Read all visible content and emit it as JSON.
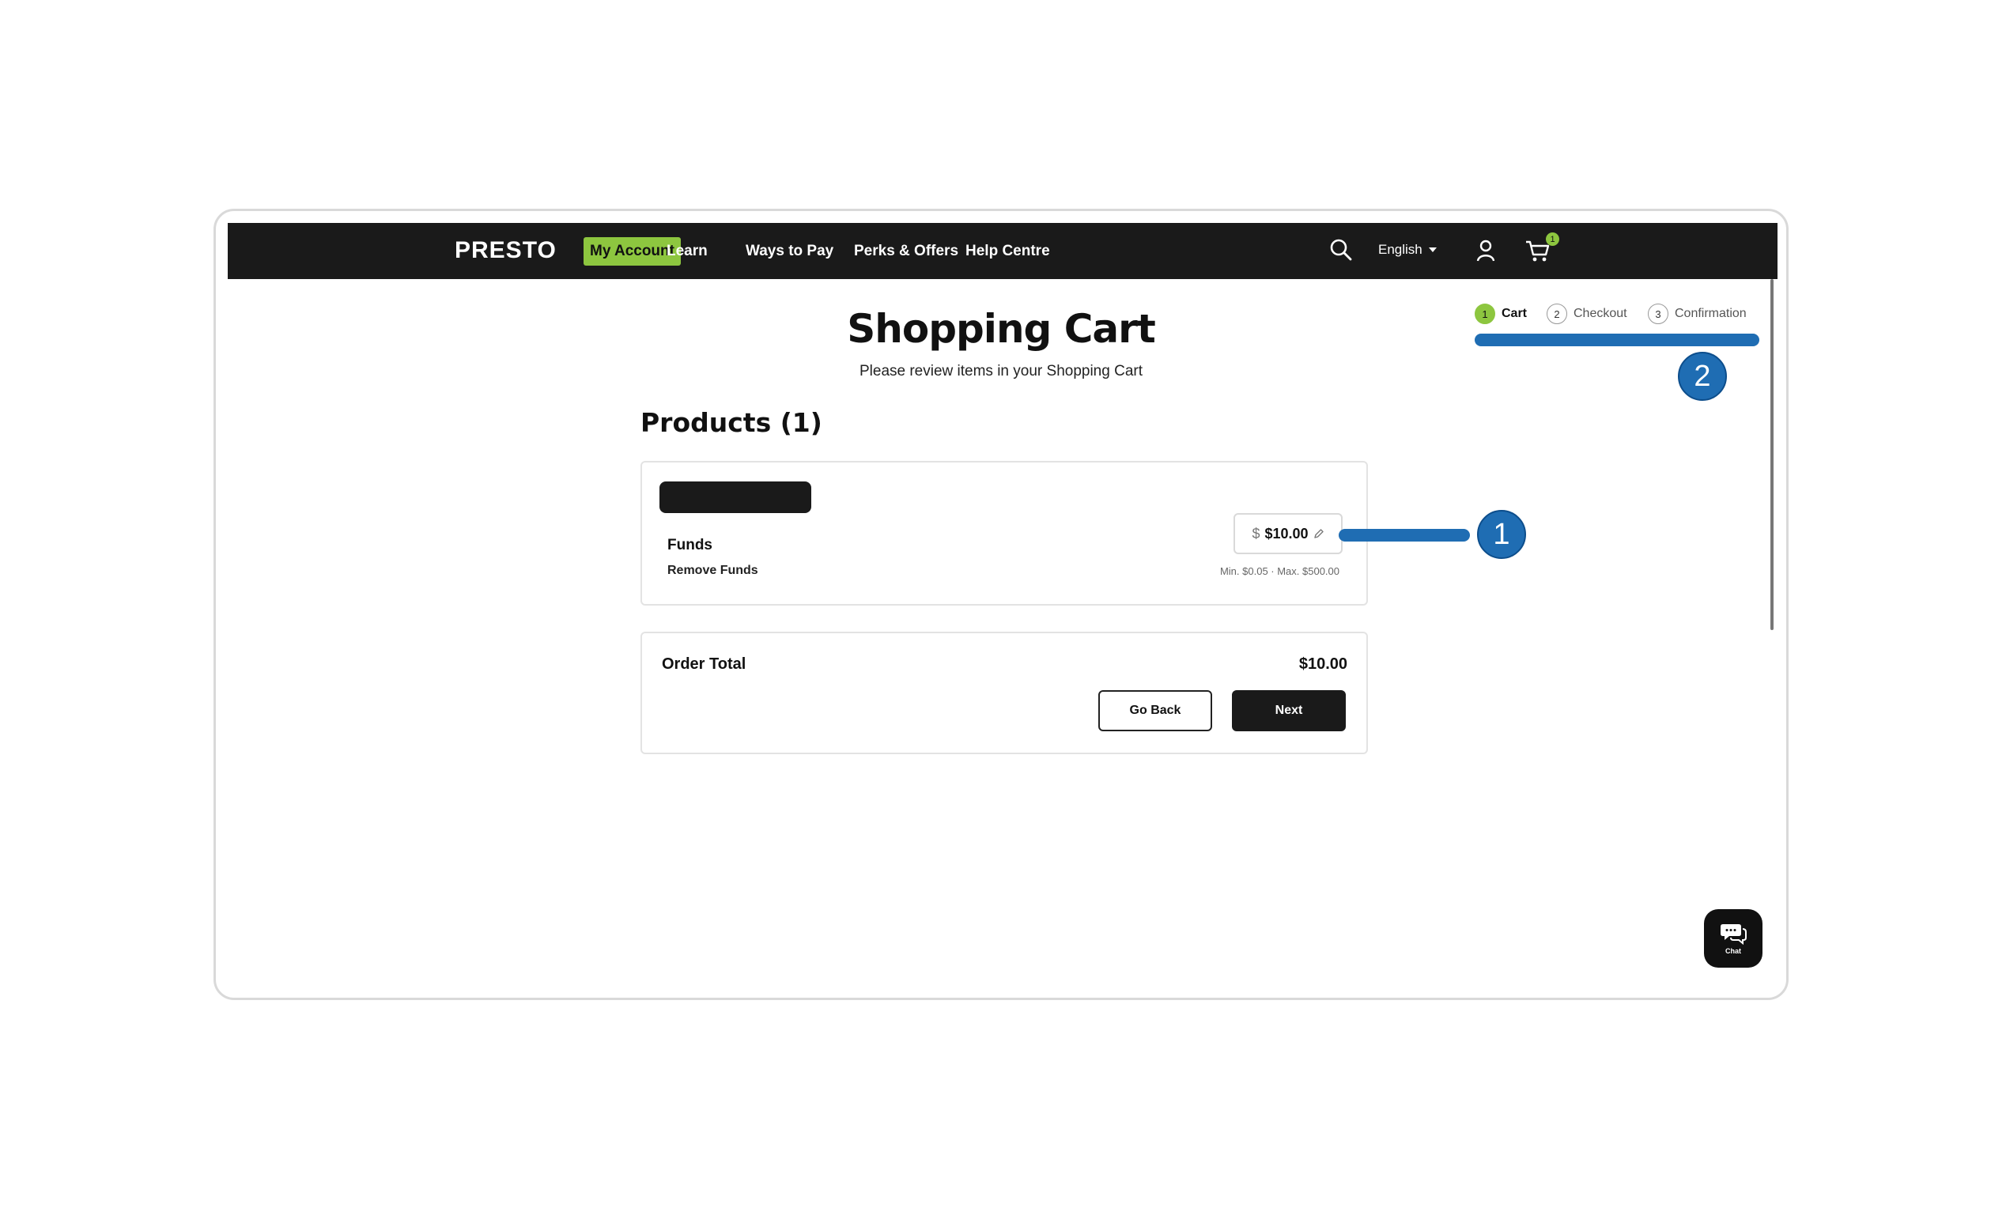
{
  "nav": {
    "logo": "PRESTO",
    "my_account": "My Account",
    "links": [
      "Learn",
      "Ways to Pay",
      "Perks & Offers",
      "Help Centre"
    ],
    "language": "English",
    "cart_count": "1",
    "icons": [
      "search-icon",
      "user-icon",
      "cart-icon",
      "chevron-down-icon"
    ]
  },
  "page": {
    "title": "Shopping Cart",
    "subtitle": "Please review items in your Shopping Cart"
  },
  "stepper": {
    "steps": [
      {
        "num": "1",
        "label": "Cart",
        "active": true
      },
      {
        "num": "2",
        "label": "Checkout",
        "active": false
      },
      {
        "num": "3",
        "label": "Confirmation",
        "active": false
      }
    ]
  },
  "products": {
    "heading": "Products (1)",
    "item": {
      "name": "Funds",
      "remove": "Remove Funds",
      "currency": "$",
      "amount": "$10.00",
      "range": "Min. $0.05 · Max. $500.00"
    }
  },
  "order": {
    "label": "Order Total",
    "total": "$10.00",
    "back": "Go Back",
    "next": "Next"
  },
  "callouts": [
    "1",
    "2"
  ],
  "chat": {
    "label": "Chat"
  },
  "colors": {
    "nav_bg": "#1a1a1a",
    "accent_green": "#8dc63f",
    "callout_blue": "#1f6db3"
  }
}
